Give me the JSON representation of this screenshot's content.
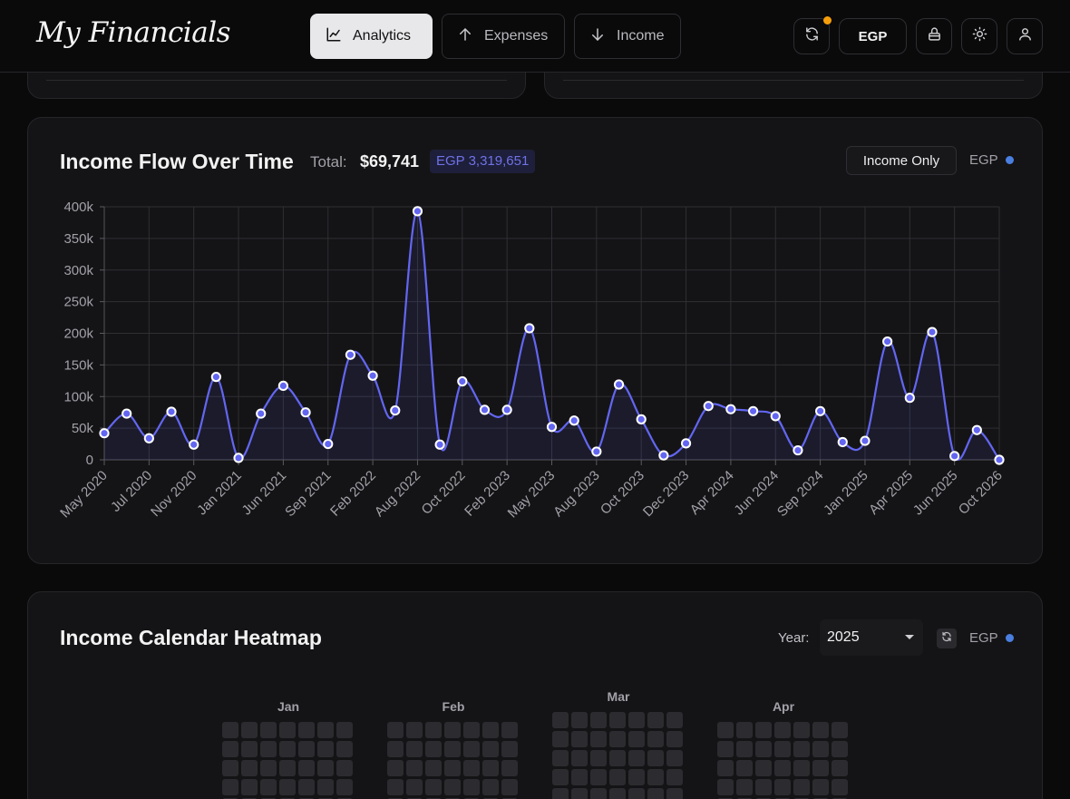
{
  "app": {
    "title": "My Financials"
  },
  "nav": {
    "analytics": "Analytics",
    "expenses": "Expenses",
    "income": "Income"
  },
  "header": {
    "currency": "EGP"
  },
  "income_chart": {
    "title": "Income Flow Over Time",
    "total_label": "Total:",
    "total_value": "$69,741",
    "total_egp": "EGP 3,319,651",
    "mode": "Income Only",
    "currency": "EGP"
  },
  "heatmap": {
    "title": "Income Calendar Heatmap",
    "year_label": "Year:",
    "year": "2025",
    "currency": "EGP",
    "months": [
      "Jan",
      "Feb",
      "Mar",
      "Apr"
    ]
  },
  "colors": {
    "line": "#6366f1",
    "accent_badge": "#f59e0b",
    "currency_dot": "#4a7fe0"
  },
  "chart_data": {
    "type": "area",
    "title": "Income Flow Over Time",
    "xlabel": "",
    "ylabel": "",
    "ylim": [
      0,
      400000
    ],
    "yticks": [
      "0",
      "50k",
      "100k",
      "150k",
      "200k",
      "250k",
      "300k",
      "350k",
      "400k"
    ],
    "xtick_labels": [
      "May 2020",
      "Jul 2020",
      "Nov 2020",
      "Jan 2021",
      "Jun 2021",
      "Sep 2021",
      "Feb 2022",
      "Aug 2022",
      "Oct 2022",
      "Feb 2023",
      "May 2023",
      "Aug 2023",
      "Oct 2023",
      "Dec 2023",
      "Apr 2024",
      "Jun 2024",
      "Sep 2024",
      "Jan 2025",
      "Apr 2025",
      "Jun 2025",
      "Oct 2026"
    ],
    "grid": true,
    "series": [
      {
        "values": [
          42000,
          73000,
          34000,
          76000,
          24000,
          131000,
          3000,
          73000,
          117000,
          75000,
          25000,
          166000,
          133000,
          78000,
          393000,
          24000,
          124000,
          79000,
          79000,
          208000,
          52000,
          62000,
          13000,
          119000,
          64000,
          7000,
          26000,
          85000,
          80000,
          77000,
          69000,
          15000,
          77000,
          28000,
          30000,
          187000,
          98000,
          202000,
          6000,
          47000,
          0
        ]
      }
    ]
  }
}
